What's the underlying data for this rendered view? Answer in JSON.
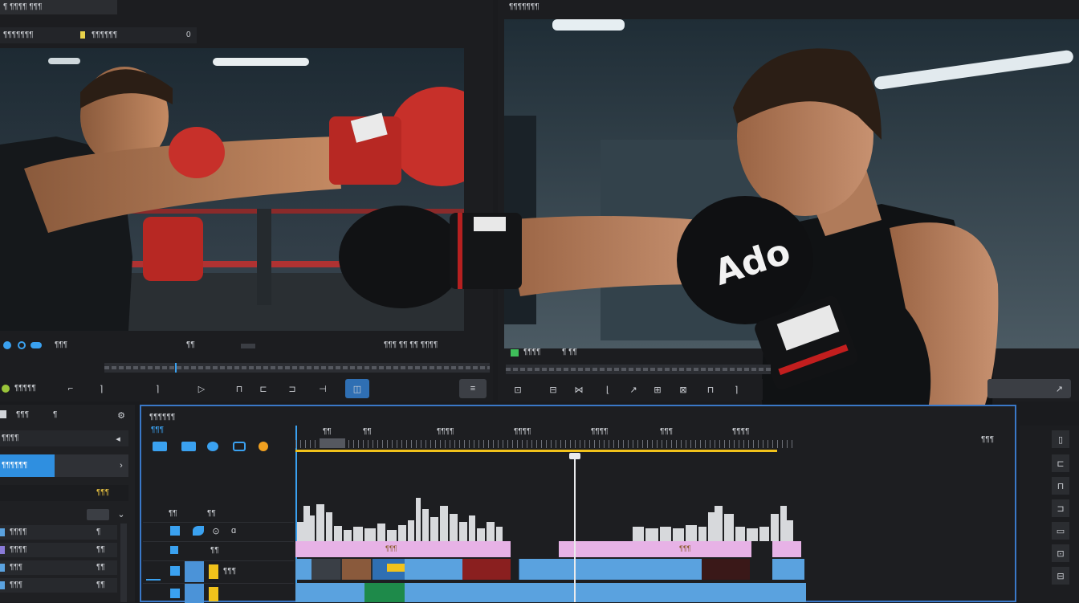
{
  "source_monitor": {
    "title": "¶ ¶¶¶¶ ¶¶¶",
    "clip_label": "¶¶¶¶¶¶¶",
    "clip_name": "¶¶¶¶¶¶",
    "clip_value": "0",
    "timecode_left": "¶¶¶",
    "timecode_mid": "¶¶",
    "timecode_right": "¶¶¶ ¶¶ ¶¶ ¶¶¶¶",
    "export_label": "¶¶¶¶¶"
  },
  "program_monitor": {
    "title": "¶¶¶¶¶¶¶",
    "timecode_left": "¶¶¶¶",
    "timecode_right": "¶ ¶¶"
  },
  "project_panel": {
    "tabs": [
      "¶¶¶",
      "¶"
    ],
    "header": "¶¶¶¶",
    "selected_item": "¶¶¶¶¶¶",
    "badge": "¶¶¶",
    "items": [
      {
        "label": "¶¶¶¶",
        "value": "¶"
      },
      {
        "label": "¶¶¶¶",
        "value": "¶¶"
      },
      {
        "label": "¶¶¶",
        "value": "¶¶"
      },
      {
        "label": "¶¶¶",
        "value": "¶¶"
      }
    ]
  },
  "timeline": {
    "title": "¶¶¶¶¶¶",
    "ruler_labels": [
      "¶¶",
      "¶¶",
      "¶¶¶¶",
      "¶¶¶¶",
      "¶¶¶¶",
      "¶¶¶",
      "¶¶¶¶"
    ],
    "right_timecode": "¶¶¶",
    "track_headers": [
      "¶¶¶",
      "¶¶",
      "¶¶",
      "¶¶",
      "¶¶¶"
    ],
    "clip_labels": [
      "¶¶¶",
      "¶¶¶"
    ],
    "playhead_fraction": 0.55
  },
  "colors": {
    "accent": "#2f8fe0",
    "clip_blue": "#5aa2df",
    "clip_pink": "#e7b2e6",
    "clip_yellow": "#f1c21b",
    "timeline_border": "#3a78c7"
  },
  "photo": {
    "glove_text": "Ado"
  }
}
